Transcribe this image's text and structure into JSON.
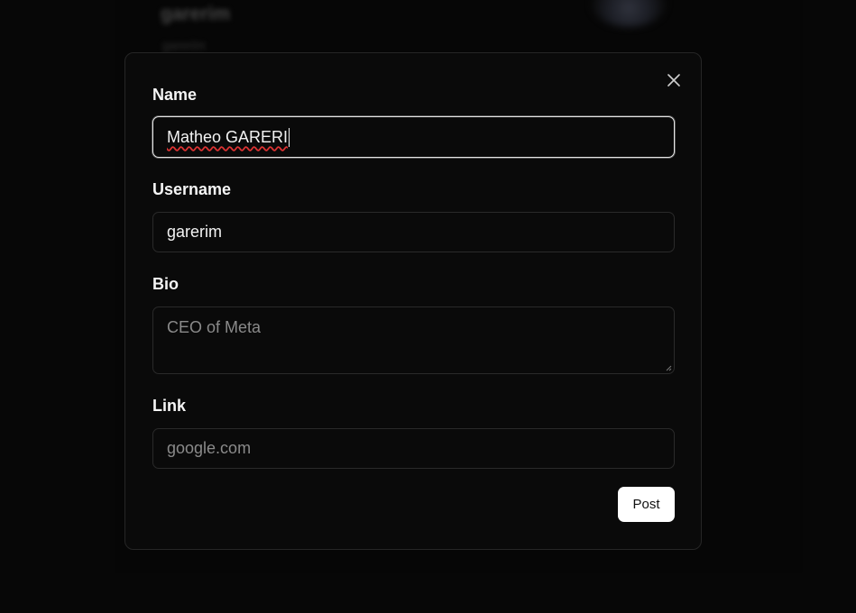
{
  "background": {
    "display_name": "garerim",
    "handle": "garerim"
  },
  "modal": {
    "close_icon": "close-icon",
    "fields": {
      "name": {
        "label": "Name",
        "value": "Matheo GARERI"
      },
      "username": {
        "label": "Username",
        "value": "garerim"
      },
      "bio": {
        "label": "Bio",
        "placeholder": "CEO of Meta"
      },
      "link": {
        "label": "Link",
        "placeholder": "google.com"
      }
    },
    "submit_label": "Post"
  },
  "colors": {
    "background": "#0a0a0a",
    "border": "#2a2a2a",
    "focus_border": "#e6e6e6",
    "button_bg": "#ffffff",
    "button_text": "#111111",
    "spellcheck": "#dd3333"
  }
}
